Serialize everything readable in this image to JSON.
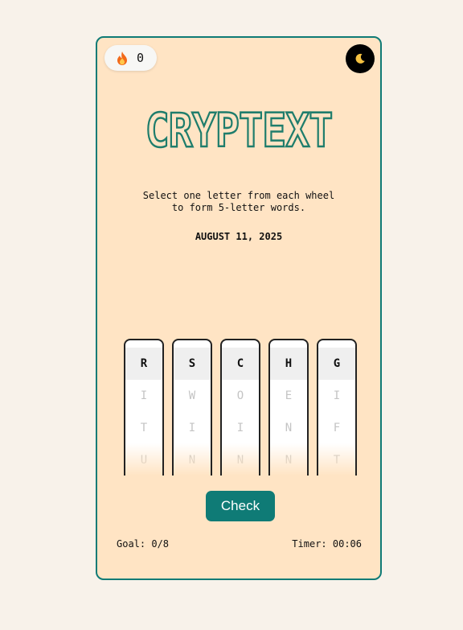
{
  "streak": {
    "count": "0",
    "icon": "fire-icon"
  },
  "theme_toggle": {
    "icon": "moon-icon"
  },
  "title": "CRYPTEXT",
  "instructions": "Select one letter from each wheel\nto form 5-letter words.",
  "date": "AUGUST 11, 2025",
  "wheels": [
    {
      "selected": "R",
      "below": [
        "I",
        "T",
        "U"
      ]
    },
    {
      "selected": "S",
      "below": [
        "W",
        "I",
        "N"
      ]
    },
    {
      "selected": "C",
      "below": [
        "O",
        "I",
        "N"
      ]
    },
    {
      "selected": "H",
      "below": [
        "E",
        "N",
        "N"
      ]
    },
    {
      "selected": "G",
      "below": [
        "I",
        "F",
        "T"
      ]
    }
  ],
  "check_label": "Check",
  "goal": "Goal: 0/8",
  "timer": "Timer: 00:06",
  "colors": {
    "page_bg": "#f8f2ea",
    "card_bg": "#ffe4c4",
    "accent": "#0f7b76",
    "title_stroke": "#1f7d6c"
  }
}
